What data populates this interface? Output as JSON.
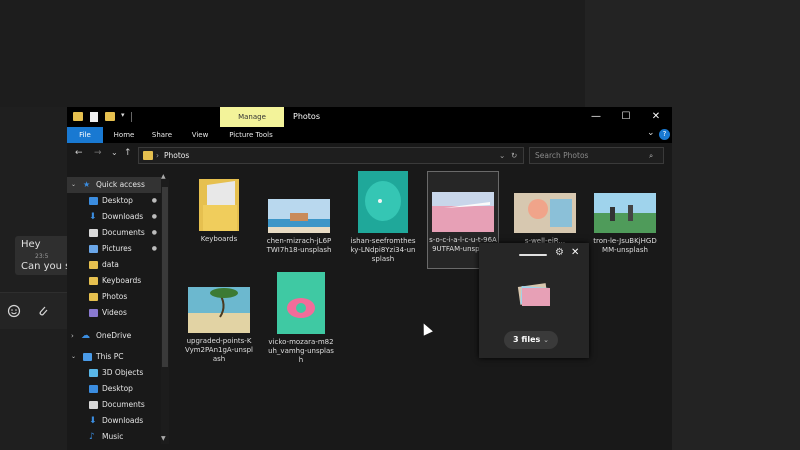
{
  "chat": {
    "messages": [
      {
        "text": "Hey",
        "time": "23:5"
      },
      {
        "text": "Can you se"
      }
    ],
    "icons": [
      "emoji-icon",
      "attach-icon"
    ]
  },
  "window": {
    "manage_tab": "Manage",
    "title": "Photos",
    "controls": {
      "minimize": "—",
      "maximize": "☐",
      "close": "✕"
    }
  },
  "ribbon": {
    "tabs": [
      "File",
      "Home",
      "Share",
      "View",
      "Picture Tools"
    ],
    "expand": "⌄",
    "help": "?"
  },
  "nav": {
    "back": "←",
    "forward": "→",
    "recent": "⌄",
    "up": "↑",
    "address": "Photos",
    "address_sep": "›",
    "refresh": "↻",
    "dropdown": "⌄",
    "search_placeholder": "Search Photos",
    "search_icon": "⌕"
  },
  "sidebar": {
    "items": [
      {
        "label": "Quick access",
        "icon": "star-icon",
        "pinned": false
      },
      {
        "label": "Desktop",
        "icon": "desktop-icon",
        "pinned": true
      },
      {
        "label": "Downloads",
        "icon": "download-icon",
        "pinned": true
      },
      {
        "label": "Documents",
        "icon": "documents-icon",
        "pinned": true
      },
      {
        "label": "Pictures",
        "icon": "pictures-icon",
        "pinned": true
      },
      {
        "label": "data",
        "icon": "folder-icon",
        "pinned": false
      },
      {
        "label": "Keyboards",
        "icon": "folder-icon",
        "pinned": false
      },
      {
        "label": "Photos",
        "icon": "folder-icon",
        "pinned": false
      },
      {
        "label": "Videos",
        "icon": "videos-icon",
        "pinned": false
      },
      {
        "label": "OneDrive",
        "icon": "cloud-icon",
        "pinned": false
      },
      {
        "label": "This PC",
        "icon": "pc-icon",
        "pinned": false
      },
      {
        "label": "3D Objects",
        "icon": "cube-icon",
        "pinned": false
      },
      {
        "label": "Desktop",
        "icon": "desktop-icon",
        "pinned": false
      },
      {
        "label": "Documents",
        "icon": "documents-icon",
        "pinned": false
      },
      {
        "label": "Downloads",
        "icon": "download-icon",
        "pinned": false
      },
      {
        "label": "Music",
        "icon": "music-icon",
        "pinned": false
      }
    ],
    "pin_glyph": "📌"
  },
  "files": [
    {
      "name": "Keyboards",
      "type": "folder"
    },
    {
      "name": "chen-mizrach-jL6PTWI7h18-unsplash",
      "type": "image"
    },
    {
      "name": "ishan-seefromthesky-LNdpi8Yzi34-unsplash",
      "type": "image"
    },
    {
      "name": "s-o-c-i-a-l-c-u-t-96A9UTFAM-unsplash",
      "type": "image",
      "selected": true
    },
    {
      "name": "s-well-eiR...",
      "type": "image"
    },
    {
      "name": "tron-le-JsuBKjHGDMM-unsplash",
      "type": "image"
    },
    {
      "name": "upgraded-points-KVym2PAn1gA-unsplash",
      "type": "image"
    },
    {
      "name": "vicko-mozara-m82uh_vamhg-unsplash",
      "type": "image"
    }
  ],
  "drag_popup": {
    "files_label": "3 files",
    "dropdown": "⌄",
    "gear": "⚙",
    "close": "✕"
  },
  "colors": {
    "accent": "#1979d2",
    "manage_tab": "#f3f39a",
    "folder": "#e6c04f"
  }
}
